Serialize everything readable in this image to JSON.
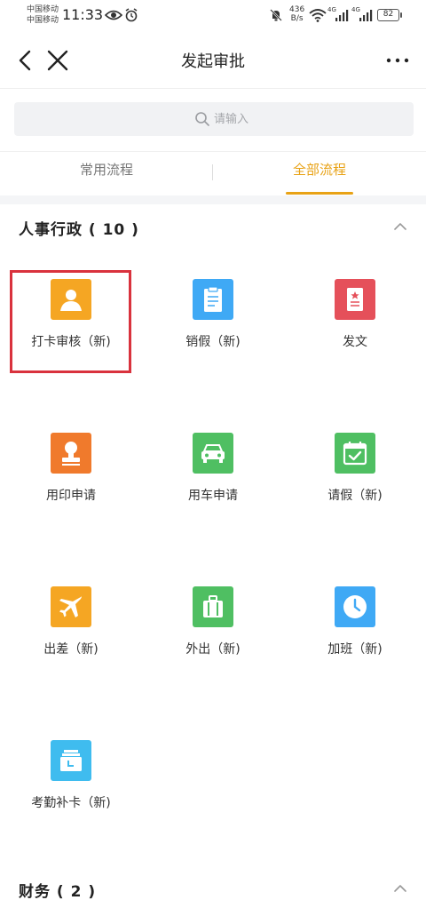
{
  "status_bar": {
    "carrier_1": "中国移动",
    "carrier_2": "中国移动",
    "time": "11:33",
    "net_speed_value": "436",
    "net_speed_unit": "B/s",
    "signal_1_label": "4G",
    "signal_2_label": "4G",
    "battery": "82"
  },
  "nav": {
    "title": "发起审批"
  },
  "search": {
    "placeholder": "请输入"
  },
  "tabs": [
    {
      "label": "常用流程",
      "active": false
    },
    {
      "label": "全部流程",
      "active": true
    }
  ],
  "sections": [
    {
      "title": "人事行政 ( 10 )",
      "expanded": true,
      "items": [
        {
          "label": "打卡审核（新)",
          "icon": "user-icon",
          "color": "#f5a623"
        },
        {
          "label": "销假（新)",
          "icon": "document-icon",
          "color": "#3fa9f5"
        },
        {
          "label": "发文",
          "icon": "official-document-icon",
          "color": "#e5505a"
        },
        {
          "label": "用印申请",
          "icon": "stamp-icon",
          "color": "#f07a2c"
        },
        {
          "label": "用车申请",
          "icon": "car-icon",
          "color": "#4fbf62"
        },
        {
          "label": "请假（新)",
          "icon": "calendar-check-icon",
          "color": "#4fbf62"
        },
        {
          "label": "出差（新)",
          "icon": "airplane-icon",
          "color": "#f5a623"
        },
        {
          "label": "外出（新)",
          "icon": "suitcase-icon",
          "color": "#4fbf62"
        },
        {
          "label": "加班（新)",
          "icon": "clock-icon",
          "color": "#3fa9f5"
        },
        {
          "label": "考勤补卡（新)",
          "icon": "attendance-card-icon",
          "color": "#3fbcef"
        }
      ]
    },
    {
      "title": "财务 ( 2 )",
      "expanded": true,
      "items": []
    }
  ],
  "colors": {
    "accent": "#e8a215",
    "highlight": "#d9323d"
  }
}
